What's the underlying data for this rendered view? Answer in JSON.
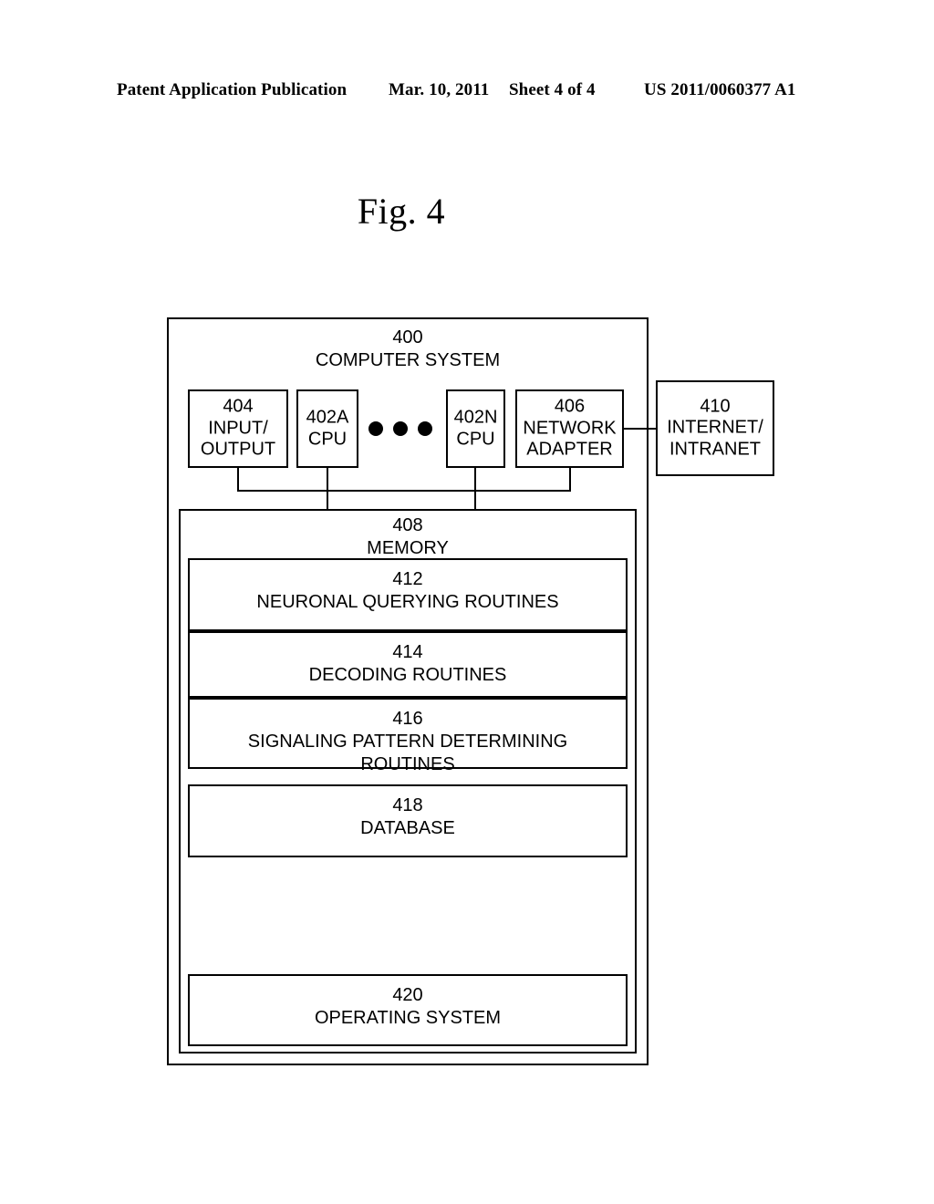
{
  "header": {
    "publication": "Patent Application Publication",
    "date": "Mar. 10, 2011",
    "sheet": "Sheet 4 of 4",
    "patent_number": "US 2011/0060377 A1"
  },
  "figure": {
    "title": "Fig. 4"
  },
  "diagram": {
    "system": {
      "number": "400",
      "label": "COMPUTER SYSTEM"
    },
    "hardware": [
      {
        "number": "404",
        "label": "INPUT/\nOUTPUT"
      },
      {
        "number": "402A",
        "label": "CPU"
      },
      {
        "number": "402N",
        "label": "CPU"
      },
      {
        "number": "406",
        "label": "NETWORK\nADAPTER"
      }
    ],
    "ellipsis": "• • •",
    "external": {
      "number": "410",
      "label": "INTERNET/\nINTRANET"
    },
    "memory": {
      "number": "408",
      "label": "MEMORY",
      "items": [
        {
          "number": "412",
          "label": "NEURONAL QUERYING ROUTINES"
        },
        {
          "number": "414",
          "label": "DECODING ROUTINES"
        },
        {
          "number": "416",
          "label": "SIGNALING PATTERN DETERMINING\nROUTINES"
        },
        {
          "number": "418",
          "label": "DATABASE"
        },
        {
          "number": "420",
          "label": "OPERATING SYSTEM"
        }
      ]
    }
  },
  "colors": {
    "line": "#000000",
    "background": "#ffffff"
  }
}
